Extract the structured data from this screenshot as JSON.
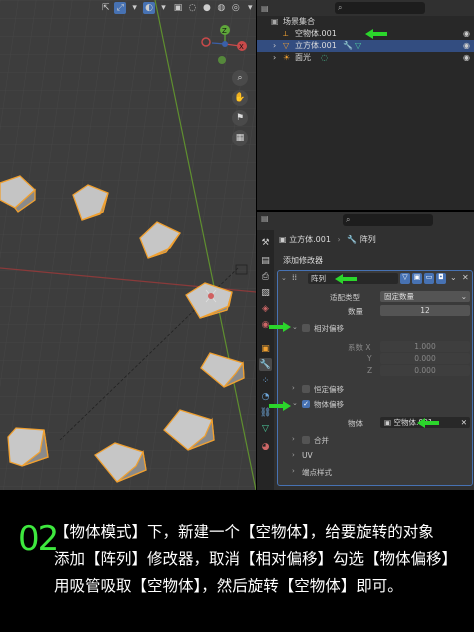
{
  "viewport": {
    "gizmo": {
      "z": "Z",
      "x": "X",
      "y": "Y"
    },
    "toolbar_icons": [
      "cursor-icon",
      "transform-icon",
      "overlay-icon",
      "xray-icon",
      "shading-wire",
      "shading-solid",
      "shading-material",
      "shading-render"
    ]
  },
  "outliner": {
    "search_icon": "⌕",
    "items": [
      {
        "label": "场景集合"
      },
      {
        "label": "空物体.001"
      },
      {
        "label": "立方体.001"
      },
      {
        "label": "面光"
      }
    ]
  },
  "properties": {
    "search_icon": "⌕",
    "breadcrumb": {
      "object": "立方体.001",
      "sep": "›",
      "modifier": "阵列"
    },
    "add_modifier": "添加修改器",
    "modifier_name": "阵列",
    "fit_type_label": "适配类型",
    "fit_type_value": "固定数量",
    "count_label": "数量",
    "count_value": "12",
    "relative_offset": "相对偏移",
    "factor_label": "系数 X",
    "factor_x": "1.000",
    "y_label": "Y",
    "factor_y": "0.000",
    "z_label": "Z",
    "factor_z": "0.000",
    "constant_offset": "恒定偏移",
    "object_offset": "物体偏移",
    "object_label": "物体",
    "object_value": "空物体.001",
    "merge": "合并",
    "uv": "UV",
    "caps": "端点样式"
  },
  "caption": {
    "step": "02",
    "line1": "【物体模式】下，新建一个【空物体】，给要旋转的对象",
    "line2": "添加【阵列】修改器，取消【相对偏移】勾选【物体偏移】",
    "line3": "用吸管吸取【空物体】，然后旋转【空物体】即可。"
  },
  "colors": {
    "accent": "#4772b3",
    "highlight_arrow": "#2bd62b",
    "cube_outline": "#f0a030",
    "caption_step": "#3ee83e"
  }
}
